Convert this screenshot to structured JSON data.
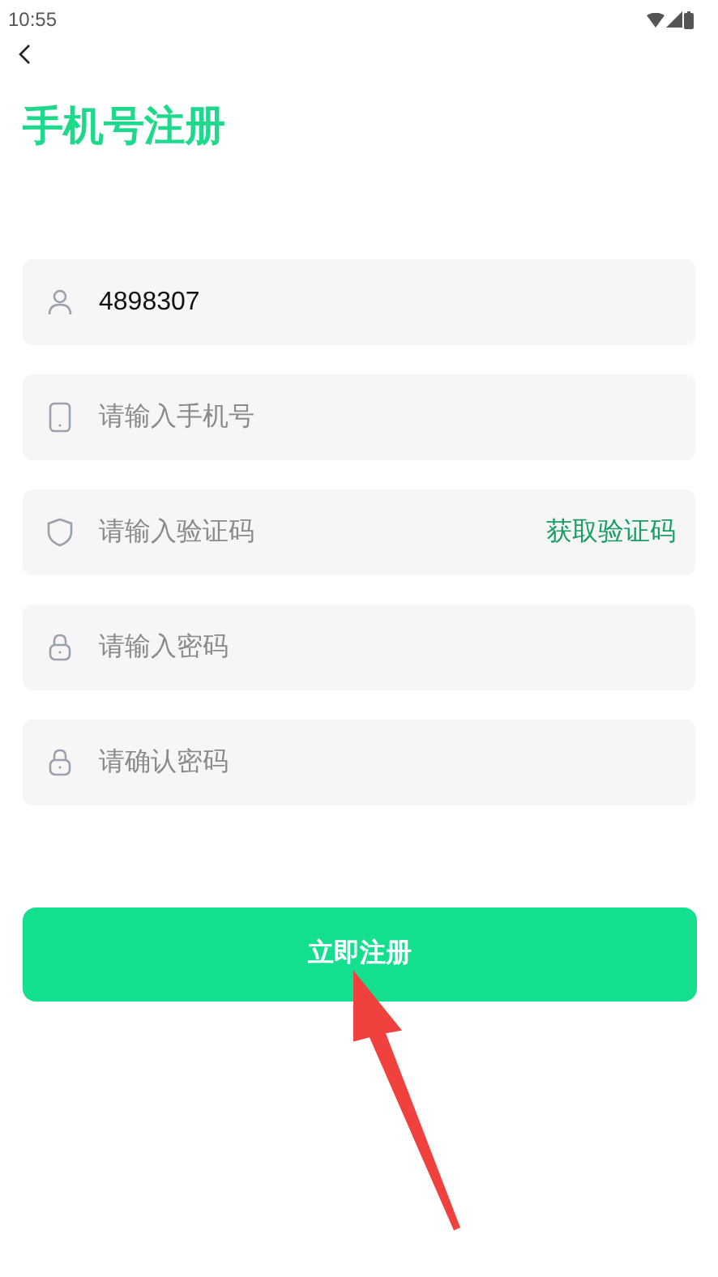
{
  "status_bar": {
    "time": "10:55"
  },
  "title": "手机号注册",
  "fields": [
    {
      "kind": "account",
      "value": "4898307"
    },
    {
      "kind": "phone",
      "placeholder": "请输入手机号"
    },
    {
      "kind": "code",
      "placeholder": "请输入验证码",
      "action": "获取验证码"
    },
    {
      "kind": "password",
      "placeholder": "请输入密码"
    },
    {
      "kind": "password",
      "placeholder": "请确认密码"
    }
  ],
  "submit_button": "立即注册",
  "arrow_annotation": true
}
